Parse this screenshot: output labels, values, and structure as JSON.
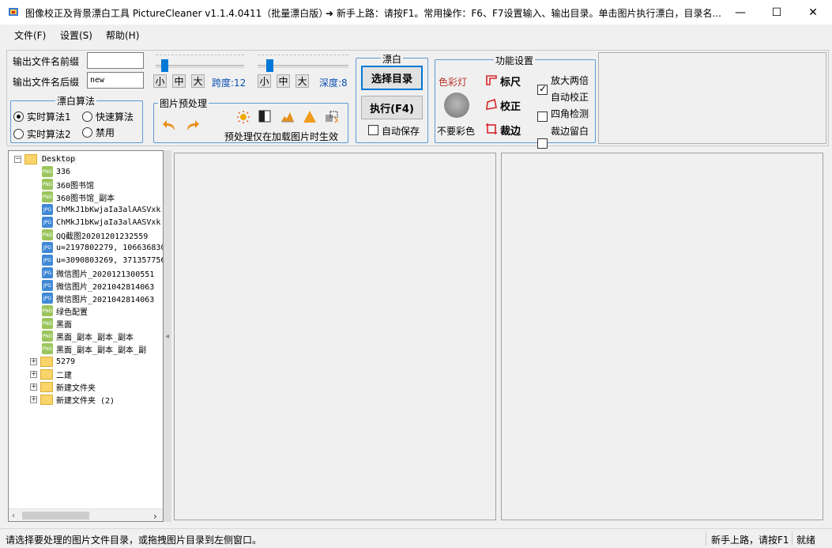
{
  "window": {
    "title": "图像校正及背景漂白工具 PictureCleaner v1.1.4.0411（批量漂白版）",
    "tip": "➜ 新手上路：请按F1。常用操作：F6、F7设置输入、输出目录。单击图片执行漂白，目录名...",
    "minimize": "—",
    "maximize": "☐",
    "close": "✕"
  },
  "menu": [
    "文件(F)",
    "设置(S)",
    "帮助(H)"
  ],
  "output": {
    "prefix_label": "输出文件名前缀",
    "prefix_value": "",
    "suffix_label": "输出文件名后缀",
    "suffix_value": "new"
  },
  "span": {
    "small": "小",
    "medium": "中",
    "large": "大",
    "label": "跨度:12"
  },
  "depth": {
    "small": "小",
    "medium": "中",
    "large": "大",
    "label": "深度:8"
  },
  "algorithm": {
    "title": "漂白算法",
    "options": [
      "实时算法1",
      "快速算法",
      "实时算法2",
      "禁用"
    ],
    "selected": "实时算法1"
  },
  "preprocess": {
    "title": "图片预处理",
    "note": "预处理仅在加载图片时生效"
  },
  "bleach": {
    "title": "漂白",
    "select_dir": "选择目录",
    "execute": "执行(F4)",
    "autosave": "自动保存"
  },
  "functions": {
    "title": "功能设置",
    "color_lamp": "色彩灯",
    "no_color": "不要彩色",
    "ruler": "标尺",
    "correct": "校正",
    "crop": "裁边",
    "options": [
      {
        "label": "放大两倍",
        "checked": true
      },
      {
        "label": "自动校正",
        "checked": false
      },
      {
        "label": "四角检测",
        "checked": false
      },
      {
        "label": "裁边留白",
        "checked": false
      }
    ]
  },
  "tree": {
    "root": "Desktop",
    "files": [
      {
        "name": "336",
        "type": "png"
      },
      {
        "name": "360图书馆",
        "type": "png"
      },
      {
        "name": "360图书馆_副本",
        "type": "png"
      },
      {
        "name": "ChMkJ1bKwjaIa3alAASVxk",
        "type": "jpg"
      },
      {
        "name": "ChMkJ1bKwjaIa3alAASVxk",
        "type": "jpg"
      },
      {
        "name": "QQ截图20201201232559",
        "type": "png"
      },
      {
        "name": "u=2197802279, 106636830",
        "type": "jpg"
      },
      {
        "name": "u=3090803269, 371357756",
        "type": "jpg"
      },
      {
        "name": "微信图片_2020121300551",
        "type": "jpg"
      },
      {
        "name": "微信图片_2021042814063",
        "type": "jpg"
      },
      {
        "name": "微信图片_2021042814063",
        "type": "jpg"
      },
      {
        "name": "绿色配置",
        "type": "png"
      },
      {
        "name": "黑面",
        "type": "png"
      },
      {
        "name": "黑面_副本_副本_副本",
        "type": "png"
      },
      {
        "name": "黑面_副本_副本_副本_副",
        "type": "png"
      }
    ],
    "folders": [
      "5279",
      "二建",
      "新建文件夹",
      "新建文件夹 (2)"
    ]
  },
  "status": {
    "left": "请选择要处理的图片文件目录，或拖拽图片目录到左侧窗口。",
    "help": "新手上路，请按F1",
    "state": "就绪"
  },
  "colors": {
    "accent": "#0078d7",
    "group_border": "#5b9bd5",
    "icon_red": "#d9252a"
  }
}
